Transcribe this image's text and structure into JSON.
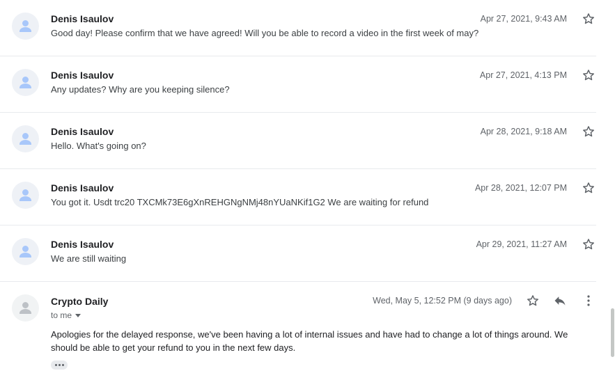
{
  "messages": [
    {
      "sender": "Denis Isaulov",
      "date": "Apr 27, 2021, 9:43 AM",
      "snippet": "Good day! Please confirm that we have agreed! Will you be able to record a video in the first week of may?"
    },
    {
      "sender": "Denis Isaulov",
      "date": "Apr 27, 2021, 4:13 PM",
      "snippet": "Any updates? Why are you keeping silence?"
    },
    {
      "sender": "Denis Isaulov",
      "date": "Apr 28, 2021, 9:18 AM",
      "snippet": "Hello. What's going on?"
    },
    {
      "sender": "Denis Isaulov",
      "date": "Apr 28, 2021, 12:07 PM",
      "snippet": "You got it. Usdt trc20 TXCMk73E6gXnREHGNgNMj48nYUaNKif1G2 We are waiting for refund"
    },
    {
      "sender": "Denis Isaulov",
      "date": "Apr 29, 2021, 11:27 AM",
      "snippet": "We are still waiting"
    }
  ],
  "open_message": {
    "sender": "Crypto Daily",
    "recipient": "to me",
    "date": "Wed, May 5, 12:52 PM (9 days ago)",
    "body": "Apologies for the delayed response, we've been having a lot of internal issues and have had to change a lot of things around. We should be able to get your refund to you in the next few days."
  },
  "icons": {
    "avatar": "person-avatar-icon",
    "star": "star-outline-icon",
    "reply": "reply-icon",
    "more": "more-vertical-icon",
    "trimmed": "show-trimmed-content-icon"
  },
  "colors": {
    "avatar_person": "#a8c7fa",
    "avatar_person_grey": "#bdc1c6",
    "divider": "#e8eaed",
    "secondary_text": "#5f6368"
  }
}
